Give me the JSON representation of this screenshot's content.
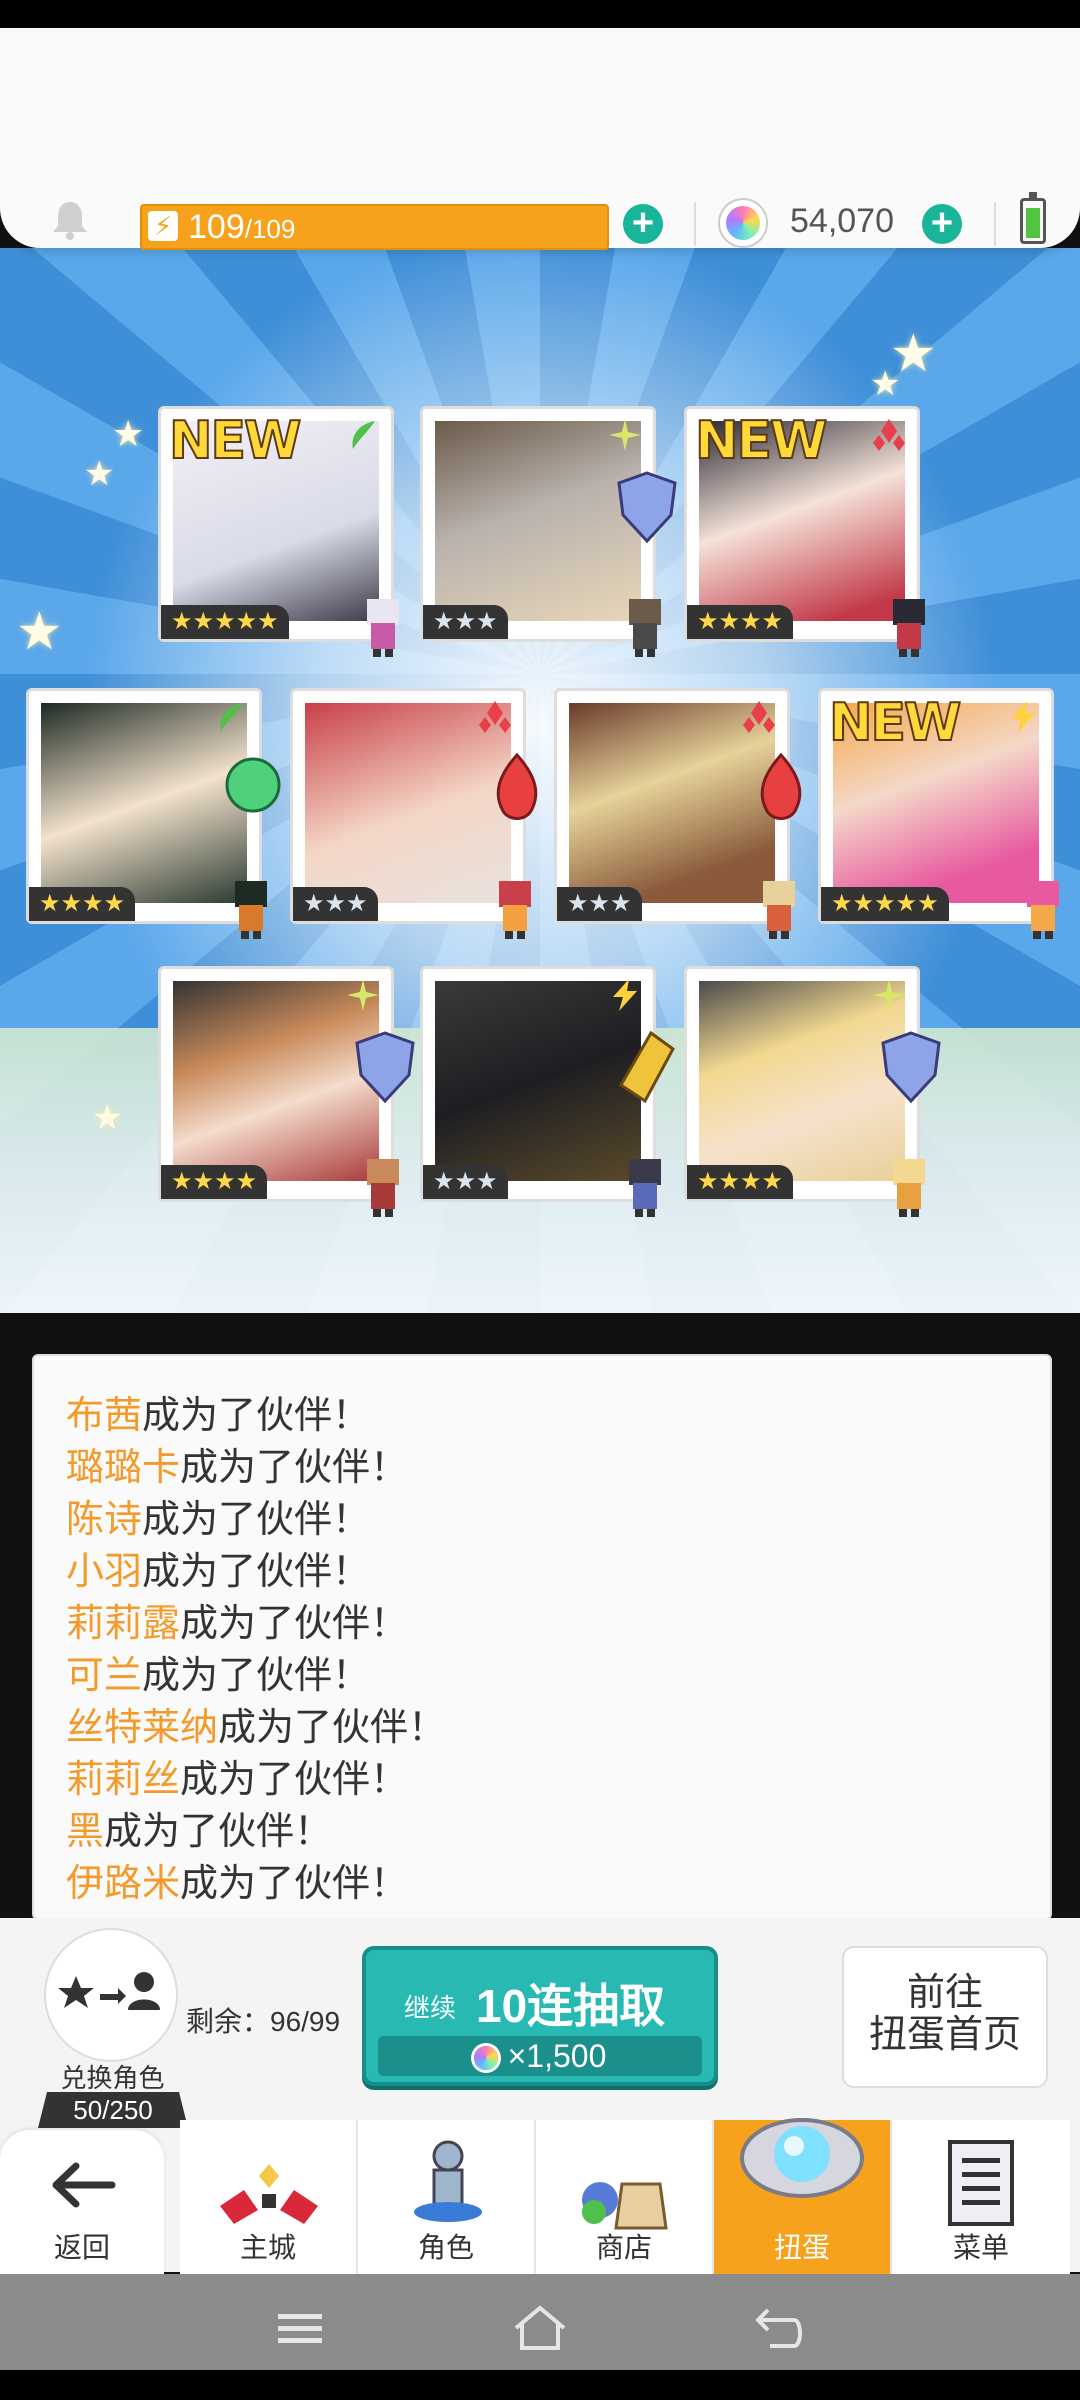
{
  "topbar": {
    "energy_current": "109",
    "energy_max": "/109",
    "gems": "54,070"
  },
  "cards": [
    {
      "name_hint": "card-1",
      "new": "NEW",
      "element": "wind",
      "rarity": "★★★★★"
    },
    {
      "name_hint": "card-2",
      "new": "",
      "element": "light",
      "rarity": "★★★"
    },
    {
      "name_hint": "card-3",
      "new": "NEW",
      "element": "fire",
      "rarity": "★★★★"
    },
    {
      "name_hint": "card-4",
      "new": "",
      "element": "wind",
      "rarity": "★★★★"
    },
    {
      "name_hint": "card-5",
      "new": "",
      "element": "fire",
      "rarity": "★★★"
    },
    {
      "name_hint": "card-6",
      "new": "",
      "element": "fire",
      "rarity": "★★★"
    },
    {
      "name_hint": "card-7",
      "new": "NEW",
      "element": "thunder",
      "rarity": "★★★★★"
    },
    {
      "name_hint": "card-8",
      "new": "",
      "element": "light",
      "rarity": "★★★★"
    },
    {
      "name_hint": "card-9",
      "new": "",
      "element": "thunder",
      "rarity": "★★★"
    },
    {
      "name_hint": "card-10",
      "new": "",
      "element": "light",
      "rarity": "★★★★"
    }
  ],
  "log": {
    "suffix": "成为了伙伴！",
    "names": [
      "布茜",
      "璐璐卡",
      "陈诗",
      "小羽",
      "莉莉露",
      "可兰",
      "丝特莱纳",
      "莉莉丝",
      "黑",
      "伊路米"
    ]
  },
  "exchange": {
    "label": "兑换角色",
    "count": "50/250"
  },
  "remain": "剩余：96/99",
  "draw": {
    "continue": "继续",
    "title": "10连抽取",
    "cost": "×1,500"
  },
  "goto": {
    "line1": "前往",
    "line2": "扭蛋首页"
  },
  "nav": {
    "back": "返回",
    "main_city": "主城",
    "character": "角色",
    "shop": "商店",
    "gacha": "扭蛋",
    "menu": "菜单"
  },
  "colors": {
    "accent_orange": "#f6a21c",
    "teal": "#28b9b3",
    "name_orange": "#f39a2a"
  }
}
